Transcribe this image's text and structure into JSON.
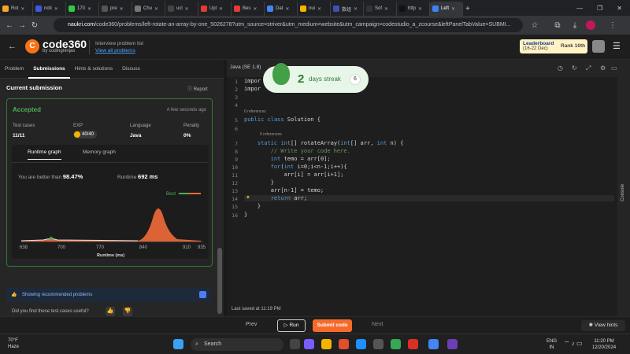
{
  "browser": {
    "tabs": [
      {
        "label": "Rot",
        "color": "#f5a623"
      },
      {
        "label": "noti",
        "color": "#3b5bdb"
      },
      {
        "label": "170",
        "color": "#2ecc40"
      },
      {
        "label": "pre",
        "color": "#555555"
      },
      {
        "label": "Chu",
        "color": "#777777"
      },
      {
        "label": "ucl",
        "color": "#444444"
      },
      {
        "label": "Upl",
        "color": "#e53935"
      },
      {
        "label": "Bes",
        "color": "#e53935"
      },
      {
        "label": "Dat",
        "color": "#4285f4"
      },
      {
        "label": "nui",
        "color": "#f5b400"
      },
      {
        "label": "数组",
        "color": "#3f51b5"
      },
      {
        "label": "Sof",
        "color": "#333333"
      },
      {
        "label": "http",
        "color": "#111111"
      },
      {
        "label": "Left",
        "color": "#3b82f6",
        "active": true
      }
    ],
    "new_tab": "+",
    "url_domain": "naukri.com",
    "url_path": "/code360/problems/left-rotate-an-array-by-one_5026278?utm_source=striver&utm_medium=website&utm_campaign=codestudio_a_zcourse&leftPanelTabValue=SUBMI..."
  },
  "header": {
    "logo_text": "code360",
    "logo_sub": "by codingninjas",
    "ipl_title": "Interview problem list",
    "ipl_link": "View all problems",
    "leaderboard_title": "Leaderboard",
    "leaderboard_dates": "(16-22 Dec)",
    "rank_label": "Rank",
    "rank_value": "10th"
  },
  "left_tabs": [
    "Problem",
    "Submissions",
    "Hints & solutions",
    "Discuss"
  ],
  "submission": {
    "section_title": "Current submission",
    "report": "Report",
    "status": "Accepted",
    "time_ago": "A few seconds ago",
    "stats": [
      {
        "label": "Test cases",
        "value": "11/11"
      },
      {
        "label": "EXP",
        "value": "40/40"
      },
      {
        "label": "Language",
        "value": "Java"
      },
      {
        "label": "Penalty",
        "value": "0%"
      }
    ],
    "graph_tabs": [
      "Runtime graph",
      "Memory graph"
    ],
    "beat_prefix": "You are better than",
    "beat_value": "98.47%",
    "runtime_label": "Runtime",
    "runtime_value": "692 ms",
    "best_label": "Best",
    "x_ticks": [
      "638",
      "700",
      "770",
      "840",
      "910",
      "935"
    ],
    "x_axis_label": "Runtime (ms)",
    "feedback": "Did you find these test cases useful?",
    "recommended": "Showing recommended problems",
    "colors": {
      "accent": "#4caf50",
      "peak": "#f26b3a"
    }
  },
  "editor": {
    "language": "Java (SE 1.8)",
    "streak_number": "2",
    "streak_text": "days streak",
    "streak_count": "6",
    "lines": [
      {
        "n": "1",
        "code": "impor"
      },
      {
        "n": "2",
        "code": "impor"
      },
      {
        "n": "3",
        "code": ""
      },
      {
        "n": "4",
        "code": ""
      },
      {
        "n": "5",
        "code": "public class Solution {"
      },
      {
        "n": "6",
        "code": ""
      },
      {
        "n": "7",
        "code": "    static int[] rotateArray(int[] arr, int n) {"
      },
      {
        "n": "8",
        "code": "        // Write your code here."
      },
      {
        "n": "9",
        "code": "        int temo = arr[0];"
      },
      {
        "n": "10",
        "code": "        for(int i=0;i<n-1;i++){"
      },
      {
        "n": "11",
        "code": "            arr[i] = arr[i+1];"
      },
      {
        "n": "12",
        "code": "        }"
      },
      {
        "n": "13",
        "code": "        arr[n-1] = temo;"
      },
      {
        "n": "14",
        "code": "        return arr;"
      },
      {
        "n": "15",
        "code": "    }"
      },
      {
        "n": "16",
        "code": "}"
      }
    ],
    "refs_label": "0 references",
    "last_saved": "Last saved at 11:19 PM",
    "console_label": "Console"
  },
  "actions": {
    "prev": "Prev",
    "run": "Run",
    "submit": "Submit code",
    "next": "Next",
    "hints": "View hints"
  },
  "taskbar": {
    "temp": "70°F",
    "weather": "Haze",
    "search": "Search",
    "lang1": "ENG",
    "lang2": "IN",
    "time": "11:20 PM",
    "date": "12/20/2024"
  }
}
